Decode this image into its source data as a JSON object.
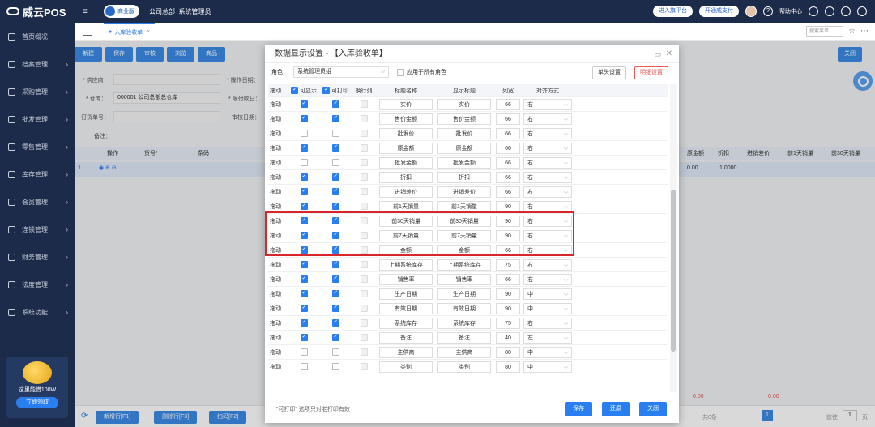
{
  "app": {
    "logo": "威云POS",
    "edition": "商业版",
    "company": "公司总部_系统管理员"
  },
  "topbar": {
    "links": [
      "进入旗平台",
      "开通威支付"
    ],
    "help": "帮助中心"
  },
  "sidebar": {
    "items": [
      "首页概况",
      "档案管理",
      "采购管理",
      "批发管理",
      "零售管理",
      "库存管理",
      "会员管理",
      "连锁管理",
      "财务管理",
      "法度管理",
      "系统功能"
    ],
    "promo_text": "这里能借100W",
    "promo_button": "立即领取"
  },
  "tabs": {
    "active": "入库验收单",
    "search_placeholder": "搜索菜单"
  },
  "toolbar": {
    "buttons": [
      "新建",
      "保存",
      "审核",
      "浏览",
      "商品"
    ],
    "close": "关闭"
  },
  "form": {
    "supplier": "* 供应商：",
    "warehouse": "* 仓库：",
    "warehouse_value": "000001  公司总部总仓库",
    "order_no": "订货单号：",
    "remark": "备注：",
    "op_date": "* 操作日期：",
    "limit_date": "* 限付款日：",
    "audit_date": "审核日期："
  },
  "grid": {
    "headers": [
      "操作",
      "货号*",
      "条码"
    ],
    "right_headers": [
      "原金额",
      "折扣",
      "进销差价",
      "前1天销量",
      "前30天销量"
    ],
    "row_index": "1",
    "row_values": [
      "0.00",
      "1.0000"
    ],
    "totals": [
      "0.00",
      "0.00"
    ],
    "pager": [
      "共0条",
      "1",
      "前往",
      "1",
      "页"
    ]
  },
  "bottom_buttons": [
    "新增行[F1]",
    "删除行[F3]",
    "扫码[F2]"
  ],
  "modal": {
    "title": "数据显示设置 - 【入库验收单】",
    "role_label": "角色：",
    "role_value": "系统管理员组",
    "all_roles": "应用于所有角色",
    "header_setting": "单头设置",
    "detail_setting": "明细设置",
    "columns": [
      "拖动",
      "可显示",
      "可打印",
      "换行列",
      "标题名称",
      "显示标题",
      "列宽",
      "对齐方式"
    ],
    "rows": [
      {
        "drag": "拖动",
        "show": true,
        "print": true,
        "name": "实价",
        "disp": "实价",
        "width": "66",
        "align": "右"
      },
      {
        "drag": "拖动",
        "show": true,
        "print": true,
        "name": "售价金额",
        "disp": "售价金额",
        "width": "66",
        "align": "右"
      },
      {
        "drag": "拖动",
        "show": false,
        "print": false,
        "name": "批发价",
        "disp": "批发价",
        "width": "66",
        "align": "右"
      },
      {
        "drag": "拖动",
        "show": true,
        "print": true,
        "name": "原金额",
        "disp": "原金额",
        "width": "66",
        "align": "右"
      },
      {
        "drag": "拖动",
        "show": false,
        "print": false,
        "name": "批发金额",
        "disp": "批发金额",
        "width": "66",
        "align": "右"
      },
      {
        "drag": "拖动",
        "show": true,
        "print": true,
        "name": "折扣",
        "disp": "折扣",
        "width": "66",
        "align": "右"
      },
      {
        "drag": "拖动",
        "show": true,
        "print": true,
        "name": "进销差价",
        "disp": "进销差价",
        "width": "66",
        "align": "右"
      },
      {
        "drag": "拖动",
        "show": true,
        "print": true,
        "name": "前1天销量",
        "disp": "前1天销量",
        "width": "90",
        "align": "右"
      },
      {
        "drag": "拖动",
        "show": true,
        "print": true,
        "name": "前30天销量",
        "disp": "前30天销量",
        "width": "90",
        "align": "右"
      },
      {
        "drag": "拖动",
        "show": true,
        "print": true,
        "name": "前7天销量",
        "disp": "前7天销量",
        "width": "90",
        "align": "右"
      },
      {
        "drag": "拖动",
        "show": true,
        "print": true,
        "name": "金额",
        "disp": "金额",
        "width": "66",
        "align": "右"
      },
      {
        "drag": "拖动",
        "show": true,
        "print": true,
        "name": "上期系统库存",
        "disp": "上期系统库存",
        "width": "75",
        "align": "右"
      },
      {
        "drag": "拖动",
        "show": true,
        "print": true,
        "name": "销售率",
        "disp": "销售率",
        "width": "66",
        "align": "右"
      },
      {
        "drag": "拖动",
        "show": true,
        "print": true,
        "name": "生产日期",
        "disp": "生产日期",
        "width": "90",
        "align": "中"
      },
      {
        "drag": "拖动",
        "show": true,
        "print": true,
        "name": "有效日期",
        "disp": "有效日期",
        "width": "90",
        "align": "中"
      },
      {
        "drag": "拖动",
        "show": true,
        "print": true,
        "name": "系统库存",
        "disp": "系统库存",
        "width": "75",
        "align": "右"
      },
      {
        "drag": "拖动",
        "show": true,
        "print": true,
        "name": "备注",
        "disp": "备注",
        "width": "40",
        "align": "左"
      },
      {
        "drag": "拖动",
        "show": false,
        "print": false,
        "name": "主供商",
        "disp": "主供商",
        "width": "80",
        "align": "中"
      },
      {
        "drag": "拖动",
        "show": false,
        "print": false,
        "name": "类别",
        "disp": "类别",
        "width": "80",
        "align": "中"
      }
    ],
    "note": "\"可打印\" 选项只对老打印有效",
    "buttons": {
      "save": "保存",
      "restore": "还原",
      "close": "关闭"
    }
  }
}
